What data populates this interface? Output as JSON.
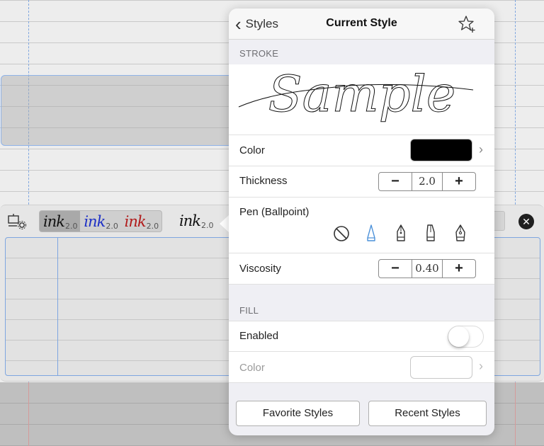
{
  "popover": {
    "nav": {
      "back_label": "Styles",
      "title": "Current Style"
    },
    "stroke": {
      "section_label": "STROKE",
      "sample_text": "Sample",
      "color_label": "Color",
      "color_value": "#000000",
      "thickness_label": "Thickness",
      "thickness_value": "2.0",
      "pen_label": "Pen (Ballpoint)",
      "pen_types": [
        "none-icon",
        "ballpoint-pen-icon",
        "fountain-pen-icon",
        "calligraphy-pen-icon",
        "nib-pen-icon"
      ],
      "pen_selected": "ballpoint-pen-icon",
      "viscosity_label": "Viscosity",
      "viscosity_value": "0.40",
      "minus": "−",
      "plus": "+"
    },
    "fill": {
      "section_label": "FILL",
      "enabled_label": "Enabled",
      "enabled": false,
      "color_label": "Color"
    },
    "footer": {
      "favorites_label": "Favorite Styles",
      "recent_label": "Recent Styles"
    }
  },
  "ink_toolbar": {
    "presets": [
      {
        "word": "ink",
        "size": "2.0",
        "color": "#111111",
        "selected": true
      },
      {
        "word": "ink",
        "size": "2.0",
        "color": "#1c2fc6",
        "selected": false
      },
      {
        "word": "ink",
        "size": "2.0",
        "color": "#b11a1a",
        "selected": false
      }
    ],
    "current_preset": {
      "word": "ink",
      "size": "2.0"
    },
    "close_symbol": "✕"
  },
  "colors": {
    "accent": "#4a90d9",
    "margin_line": "#7ea6e0"
  }
}
